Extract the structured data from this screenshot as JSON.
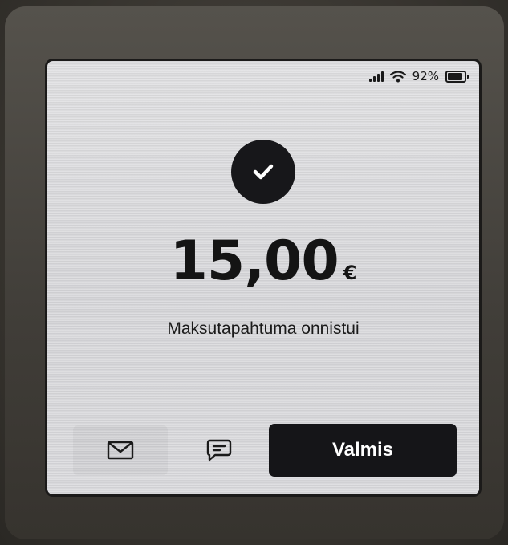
{
  "status_bar": {
    "battery_percent_label": "92%",
    "battery_level": 0.92
  },
  "payment": {
    "amount": "15,00",
    "currency": "€",
    "status_message": "Maksutapahtuma onnistui"
  },
  "actions": {
    "email_icon": "envelope-icon",
    "sms_icon": "message-icon",
    "done_label": "Valmis"
  },
  "colors": {
    "screen_background": "#dcdcdf",
    "accent_dark": "#151518",
    "text": "#141414"
  }
}
